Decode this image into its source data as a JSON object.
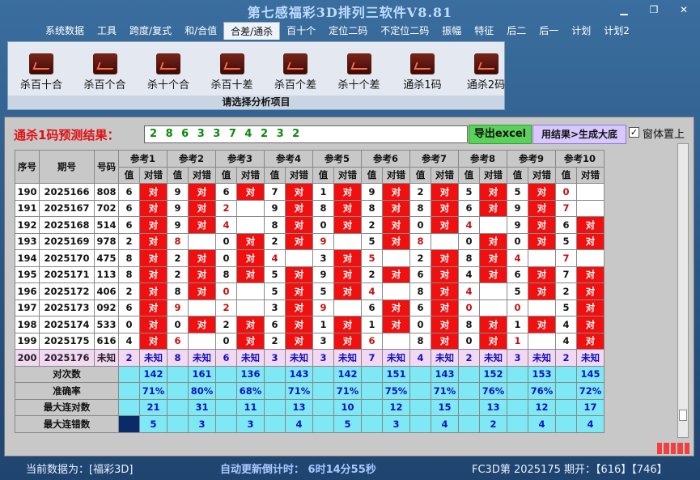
{
  "window": {
    "title": "第七感福彩3D排列三软件V8.81",
    "minimize": "▁",
    "restore": "❐",
    "close": "✕"
  },
  "menu": [
    "系统数据",
    "工具",
    "跨度/复式",
    "和/合值",
    "合差/通杀",
    "百十个",
    "定位二码",
    "不定位二码",
    "振幅",
    "特征",
    "后二",
    "后一",
    "计划",
    "计划2"
  ],
  "menu_active": 4,
  "ribbon": {
    "buttons": [
      "杀百十合",
      "杀百个合",
      "杀十个合",
      "杀百十差",
      "杀百个差",
      "杀十个差",
      "通杀1码",
      "通杀2码"
    ],
    "footer": "请选择分析项目"
  },
  "prediction": {
    "label": "通杀1码预测结果：",
    "value": "2 8 6 3 3 7 4 2 3 2",
    "export_btn": "导出excel",
    "gen_btn": "用结果>生成大底",
    "topmost_check": "✓",
    "topmost_label": "窗体置上"
  },
  "table": {
    "header": {
      "seq": "序号",
      "period": "期号",
      "number": "号码",
      "refs": [
        "参考1",
        "参考2",
        "参考3",
        "参考4",
        "参考5",
        "参考6",
        "参考7",
        "参考8",
        "参考9",
        "参考10"
      ],
      "val": "值",
      "res": "对错"
    },
    "rows": [
      {
        "seq": "190",
        "period": "2025166",
        "number": "808",
        "cells": [
          [
            "6",
            "对"
          ],
          [
            "9",
            "对"
          ],
          [
            "6",
            "对"
          ],
          [
            "7",
            "对"
          ],
          [
            "1",
            "对"
          ],
          [
            "9",
            "对"
          ],
          [
            "2",
            "对"
          ],
          [
            "5",
            "对"
          ],
          [
            "5",
            "对"
          ],
          [
            "0",
            ""
          ]
        ]
      },
      {
        "seq": "191",
        "period": "2025167",
        "number": "702",
        "cells": [
          [
            "6",
            "对"
          ],
          [
            "9",
            "对"
          ],
          [
            "2",
            ""
          ],
          [
            "9",
            "对"
          ],
          [
            "8",
            "对"
          ],
          [
            "8",
            "对"
          ],
          [
            "8",
            "对"
          ],
          [
            "6",
            "对"
          ],
          [
            "9",
            "对"
          ],
          [
            "7",
            ""
          ]
        ]
      },
      {
        "seq": "192",
        "period": "2025168",
        "number": "514",
        "cells": [
          [
            "6",
            "对"
          ],
          [
            "9",
            "对"
          ],
          [
            "4",
            ""
          ],
          [
            "8",
            "对"
          ],
          [
            "0",
            "对"
          ],
          [
            "2",
            "对"
          ],
          [
            "0",
            "对"
          ],
          [
            "4",
            ""
          ],
          [
            "9",
            "对"
          ],
          [
            "6",
            "对"
          ]
        ]
      },
      {
        "seq": "193",
        "period": "2025169",
        "number": "978",
        "cells": [
          [
            "2",
            "对"
          ],
          [
            "8",
            ""
          ],
          [
            "0",
            "对"
          ],
          [
            "2",
            "对"
          ],
          [
            "9",
            ""
          ],
          [
            "5",
            "对"
          ],
          [
            "8",
            ""
          ],
          [
            "0",
            "对"
          ],
          [
            "0",
            "对"
          ],
          [
            "5",
            "对"
          ]
        ]
      },
      {
        "seq": "194",
        "period": "2025170",
        "number": "475",
        "cells": [
          [
            "8",
            "对"
          ],
          [
            "2",
            "对"
          ],
          [
            "0",
            "对"
          ],
          [
            "4",
            ""
          ],
          [
            "3",
            "对"
          ],
          [
            "5",
            ""
          ],
          [
            "2",
            "对"
          ],
          [
            "8",
            "对"
          ],
          [
            "4",
            ""
          ],
          [
            "7",
            ""
          ]
        ]
      },
      {
        "seq": "195",
        "period": "2025171",
        "number": "113",
        "cells": [
          [
            "8",
            "对"
          ],
          [
            "2",
            "对"
          ],
          [
            "8",
            "对"
          ],
          [
            "5",
            "对"
          ],
          [
            "9",
            "对"
          ],
          [
            "2",
            "对"
          ],
          [
            "6",
            "对"
          ],
          [
            "4",
            "对"
          ],
          [
            "6",
            "对"
          ],
          [
            "7",
            "对"
          ]
        ]
      },
      {
        "seq": "196",
        "period": "2025172",
        "number": "406",
        "cells": [
          [
            "2",
            "对"
          ],
          [
            "8",
            "对"
          ],
          [
            "0",
            ""
          ],
          [
            "5",
            "对"
          ],
          [
            "5",
            "对"
          ],
          [
            "4",
            ""
          ],
          [
            "8",
            "对"
          ],
          [
            "4",
            ""
          ],
          [
            "5",
            "对"
          ],
          [
            "2",
            "对"
          ]
        ]
      },
      {
        "seq": "197",
        "period": "2025173",
        "number": "092",
        "cells": [
          [
            "6",
            "对"
          ],
          [
            "9",
            ""
          ],
          [
            "2",
            ""
          ],
          [
            "3",
            "对"
          ],
          [
            "9",
            ""
          ],
          [
            "6",
            "对"
          ],
          [
            "6",
            "对"
          ],
          [
            "0",
            ""
          ],
          [
            "0",
            ""
          ],
          [
            "5",
            "对"
          ]
        ]
      },
      {
        "seq": "198",
        "period": "2025174",
        "number": "533",
        "cells": [
          [
            "0",
            "对"
          ],
          [
            "0",
            "对"
          ],
          [
            "2",
            "对"
          ],
          [
            "6",
            "对"
          ],
          [
            "1",
            "对"
          ],
          [
            "1",
            "对"
          ],
          [
            "0",
            "对"
          ],
          [
            "8",
            "对"
          ],
          [
            "1",
            "对"
          ],
          [
            "4",
            "对"
          ]
        ]
      },
      {
        "seq": "199",
        "period": "2025175",
        "number": "616",
        "cells": [
          [
            "4",
            "对"
          ],
          [
            "6",
            ""
          ],
          [
            "0",
            "对"
          ],
          [
            "2",
            "对"
          ],
          [
            "3",
            "对"
          ],
          [
            "6",
            ""
          ],
          [
            "8",
            "对"
          ],
          [
            "0",
            "对"
          ],
          [
            "1",
            ""
          ],
          [
            "4",
            "对"
          ]
        ]
      },
      {
        "seq": "200",
        "period": "2025176",
        "number": "未知",
        "cells": [
          [
            "2",
            "未知"
          ],
          [
            "8",
            "未知"
          ],
          [
            "6",
            "未知"
          ],
          [
            "3",
            "未知"
          ],
          [
            "3",
            "未知"
          ],
          [
            "7",
            "未知"
          ],
          [
            "4",
            "未知"
          ],
          [
            "2",
            "未知"
          ],
          [
            "3",
            "未知"
          ],
          [
            "2",
            "未知"
          ]
        ]
      }
    ],
    "stats": [
      {
        "label": "对次数",
        "values": [
          "142",
          "161",
          "136",
          "143",
          "142",
          "151",
          "143",
          "152",
          "153",
          "145"
        ]
      },
      {
        "label": "准确率",
        "values": [
          "71%",
          "80%",
          "68%",
          "71%",
          "71%",
          "75%",
          "71%",
          "76%",
          "76%",
          "72%"
        ]
      },
      {
        "label": "最大连对数",
        "values": [
          "21",
          "31",
          "11",
          "13",
          "10",
          "12",
          "15",
          "13",
          "12",
          "17"
        ]
      },
      {
        "label": "最大连错数",
        "values": [
          "5",
          "3",
          "3",
          "4",
          "5",
          "3",
          "4",
          "2",
          "4",
          "4"
        ]
      }
    ]
  },
  "status": {
    "current": "当前数据为：[福彩3D]",
    "countdown": "自动更新倒计时： 6时14分55秒",
    "latest": "FC3D第 2025175 期开：【616】【746】"
  }
}
